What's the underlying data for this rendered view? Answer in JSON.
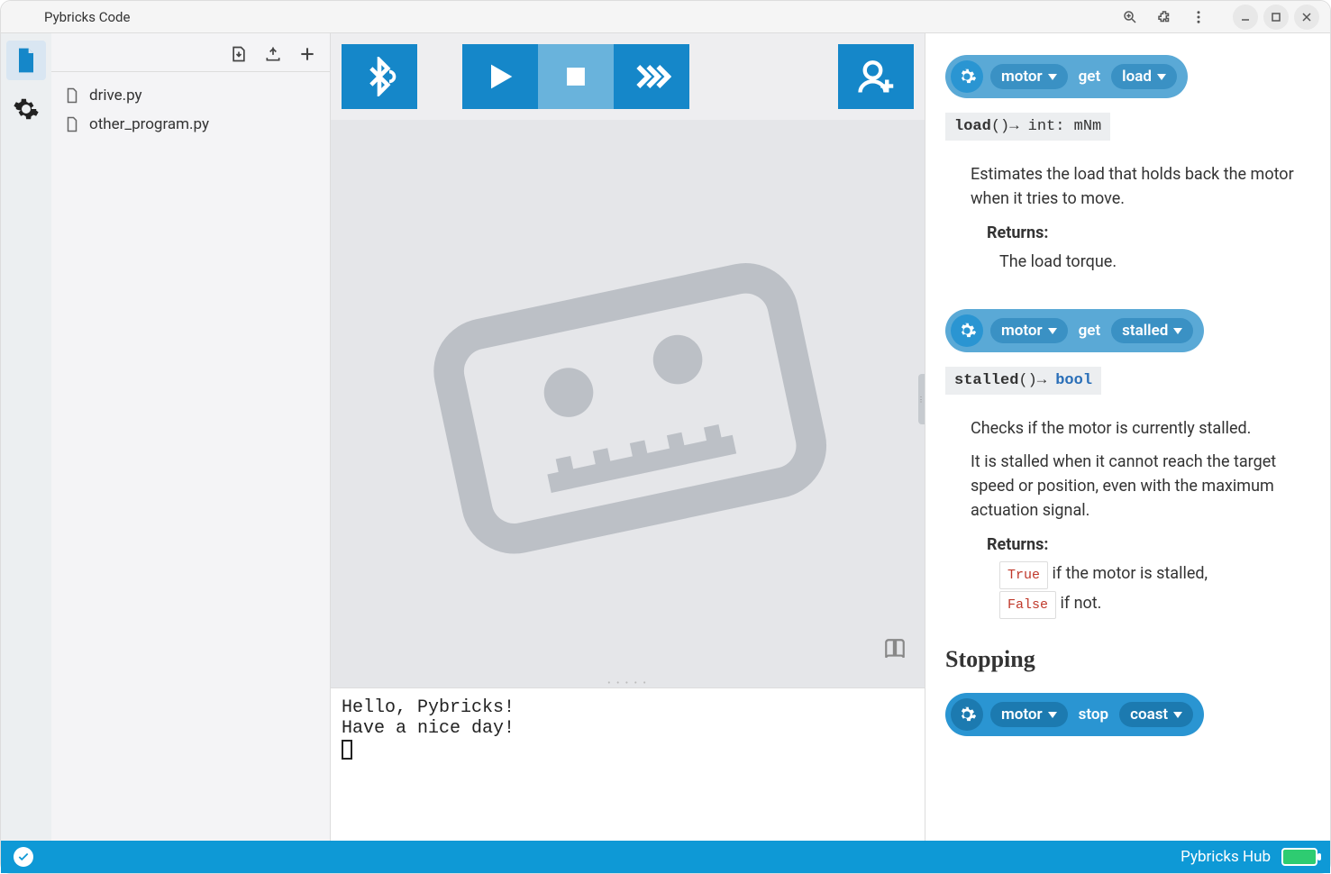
{
  "window": {
    "title": "Pybricks Code"
  },
  "files": [
    {
      "name": "drive.py"
    },
    {
      "name": "other_program.py"
    }
  ],
  "terminal": {
    "line1": "Hello, Pybricks!",
    "line2": "Have a nice day!"
  },
  "docs": {
    "block1": {
      "object": "motor",
      "verb": "get",
      "prop": "load"
    },
    "sig1": {
      "name": "load",
      "ret": "int: mNm"
    },
    "desc1": "Estimates the load that holds back the motor when it tries to move.",
    "returns_label": "Returns:",
    "ret1": "The load torque.",
    "block2": {
      "object": "motor",
      "verb": "get",
      "prop": "stalled"
    },
    "sig2": {
      "name": "stalled",
      "ret": "bool"
    },
    "desc2a": "Checks if the motor is currently stalled.",
    "desc2b": "It is stalled when it cannot reach the target speed or position, even with the maximum actuation signal.",
    "ret2a_code": "True",
    "ret2a_text": " if the motor is stalled, ",
    "ret2b_code": "False",
    "ret2b_text": " if not.",
    "heading": "Stopping",
    "block3": {
      "object": "motor",
      "verb": "stop",
      "prop": "coast"
    }
  },
  "statusbar": {
    "hub": "Pybricks Hub"
  }
}
